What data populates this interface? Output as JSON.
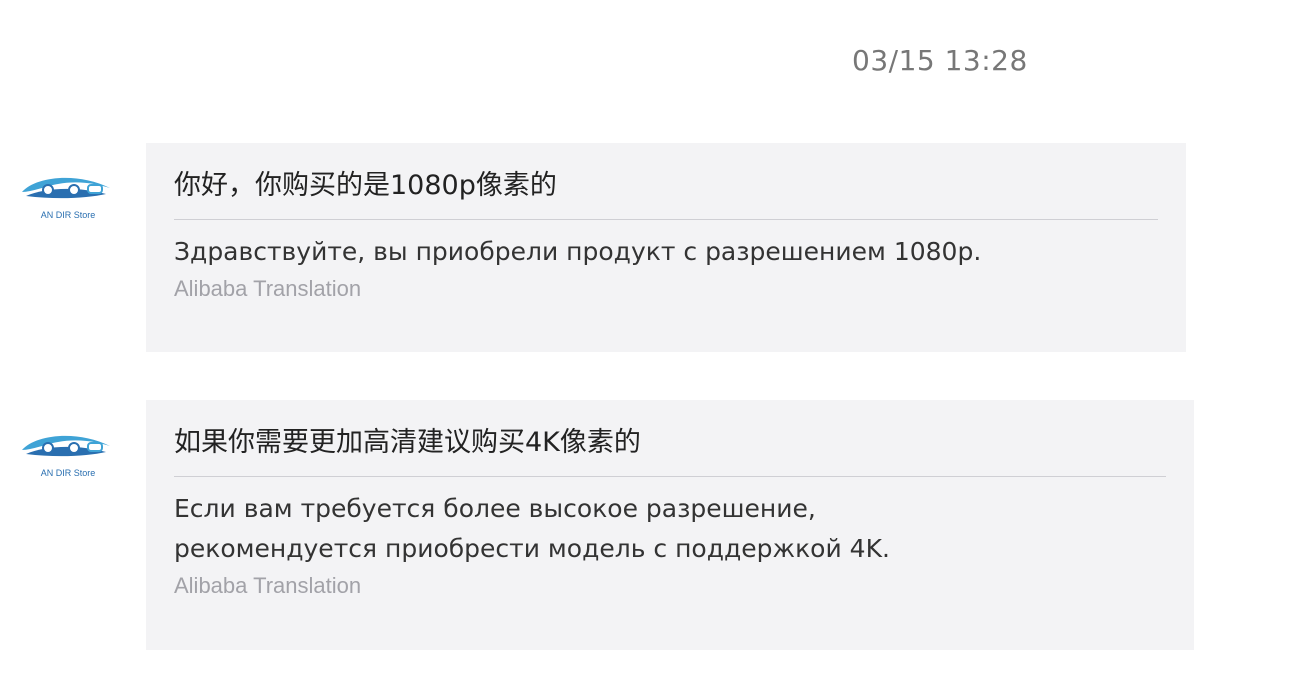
{
  "timestamp": "03/15 13:28",
  "messages": [
    {
      "avatar_text": "AN DIR Store",
      "original": "你好，你购买的是1080p像素的",
      "translation": "Здравствуйте, вы приобрели продукт с разрешением 1080р.",
      "provider": "Alibaba Translation"
    },
    {
      "avatar_text": "AN DIR Store",
      "original": "如果你需要更加高清建议购买4K像素的",
      "translation_lines": [
        "Если вам требуется более высокое разрешение,",
        "рекомендуется приобрести модель с поддержкой 4K."
      ],
      "provider": "Alibaba Translation"
    }
  ],
  "colors": {
    "bubble_bg": "#f3f3f5",
    "avatar_blue": "#2a6fb0",
    "provider_gray": "#a2a2a8"
  },
  "icons": {
    "avatar": "store-logo-icon"
  }
}
